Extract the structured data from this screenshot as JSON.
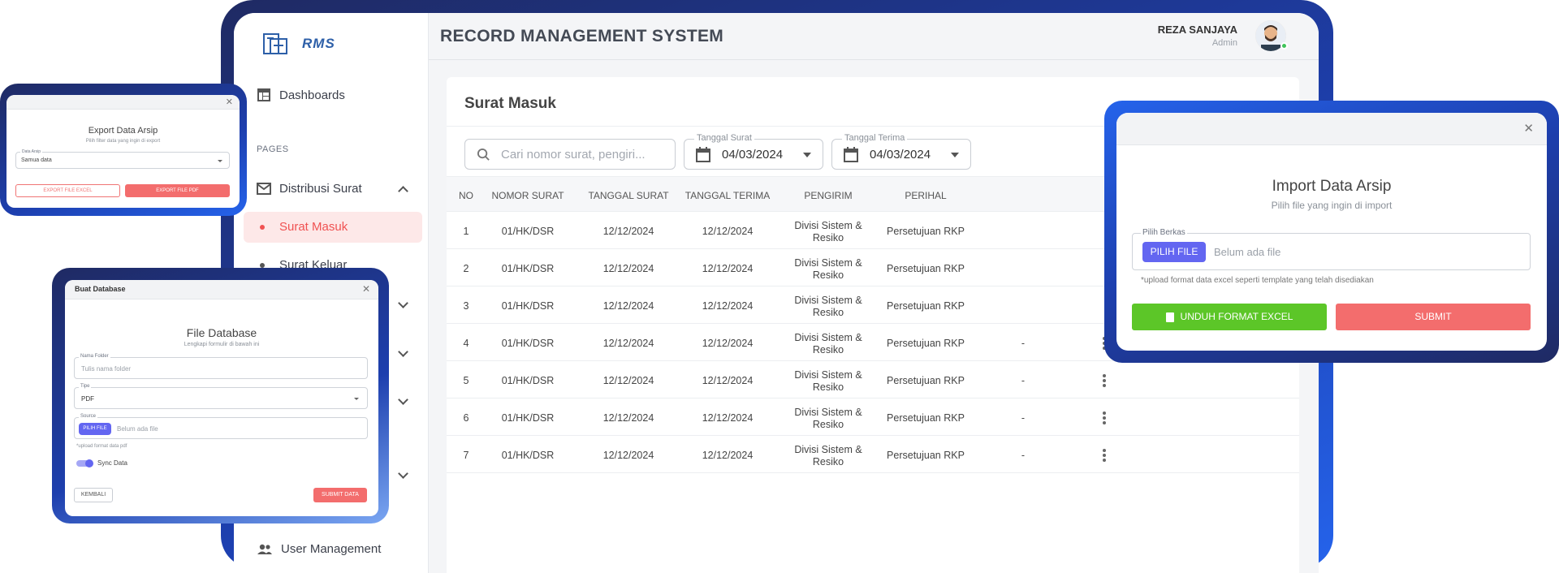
{
  "app": {
    "title": "RECORD MANAGEMENT SYSTEM",
    "logo_text": "RMS",
    "user": {
      "name": "REZA SANJAYA",
      "role": "Admin"
    }
  },
  "sidebar": {
    "dashboards": "Dashboards",
    "section_caption": "PAGES",
    "distribusi": "Distribusi Surat",
    "surat_masuk": "Surat Masuk",
    "surat_keluar": "Surat Keluar",
    "user_management": "User Management"
  },
  "page": {
    "title": "Surat Masuk",
    "search_placeholder": "Cari nomor surat, pengiri...",
    "filters": {
      "tanggal_surat": {
        "label": "Tanggal Surat",
        "value": "04/03/2024"
      },
      "tanggal_terima": {
        "label": "Tanggal Terima",
        "value": "04/03/2024"
      }
    },
    "table": {
      "headers": [
        "NO",
        "NOMOR SURAT",
        "TANGGAL SURAT",
        "TANGGAL TERIMA",
        "PENGIRIM",
        "PERIHAL"
      ],
      "rows": [
        {
          "no": "1",
          "nomor": "01/HK/DSR",
          "tgl_surat": "12/12/2024",
          "tgl_terima": "12/12/2024",
          "pengirim1": "Divisi Sistem &",
          "pengirim2": "Resiko",
          "perihal": "Persetujuan RKP",
          "extra": ""
        },
        {
          "no": "2",
          "nomor": "01/HK/DSR",
          "tgl_surat": "12/12/2024",
          "tgl_terima": "12/12/2024",
          "pengirim1": "Divisi Sistem &",
          "pengirim2": "Resiko",
          "perihal": "Persetujuan RKP",
          "extra": ""
        },
        {
          "no": "3",
          "nomor": "01/HK/DSR",
          "tgl_surat": "12/12/2024",
          "tgl_terima": "12/12/2024",
          "pengirim1": "Divisi Sistem &",
          "pengirim2": "Resiko",
          "perihal": "Persetujuan RKP",
          "extra": ""
        },
        {
          "no": "4",
          "nomor": "01/HK/DSR",
          "tgl_surat": "12/12/2024",
          "tgl_terima": "12/12/2024",
          "pengirim1": "Divisi Sistem &",
          "pengirim2": "Resiko",
          "perihal": "Persetujuan RKP",
          "extra": "-"
        },
        {
          "no": "5",
          "nomor": "01/HK/DSR",
          "tgl_surat": "12/12/2024",
          "tgl_terima": "12/12/2024",
          "pengirim1": "Divisi Sistem &",
          "pengirim2": "Resiko",
          "perihal": "Persetujuan RKP",
          "extra": "-"
        },
        {
          "no": "6",
          "nomor": "01/HK/DSR",
          "tgl_surat": "12/12/2024",
          "tgl_terima": "12/12/2024",
          "pengirim1": "Divisi Sistem &",
          "pengirim2": "Resiko",
          "perihal": "Persetujuan RKP",
          "extra": "-"
        },
        {
          "no": "7",
          "nomor": "01/HK/DSR",
          "tgl_surat": "12/12/2024",
          "tgl_terima": "12/12/2024",
          "pengirim1": "Divisi Sistem &",
          "pengirim2": "Resiko",
          "perihal": "Persetujuan RKP",
          "extra": "-"
        }
      ]
    }
  },
  "export_modal": {
    "title": "Export Data Arsip",
    "subtitle": "Pilih filter data yang ingin di export",
    "field_label": "Data Arsip",
    "field_value": "Samua data",
    "btn_excel": "EXPORT FILE EXCEL",
    "btn_pdf": "EXPORT FILE PDF"
  },
  "db_modal": {
    "header": "Buat Database",
    "title": "File Database",
    "subtitle": "Lengkapi formulir di bawah ini",
    "folder_label": "Nama Folder",
    "folder_placeholder": "Tulis nama folder",
    "tipe_label": "Tipe",
    "tipe_value": "PDF",
    "source_label": "Source",
    "pilih_file": "PILIH FILE",
    "no_file": "Belum ada file",
    "hint": "*upload format data pdf",
    "sync_label": "Sync Data",
    "btn_back": "KEMBALI",
    "btn_submit": "SUBMIT DATA"
  },
  "import_modal": {
    "title": "Import Data Arsip",
    "subtitle": "Pilih file yang ingin di import",
    "field_label": "Pilih Berkas",
    "pilih_file": "PILIH FILE",
    "no_file": "Belum ada file",
    "hint": "*upload format data excel seperti template yang telah disediakan",
    "btn_download": "UNDUH FORMAT EXCEL",
    "btn_submit": "SUBMIT"
  },
  "colors": {
    "accent_red": "#f36d6d",
    "accent_green": "#5cc628",
    "accent_purple": "#6366f1",
    "frame_blue": "#1d3fae"
  }
}
